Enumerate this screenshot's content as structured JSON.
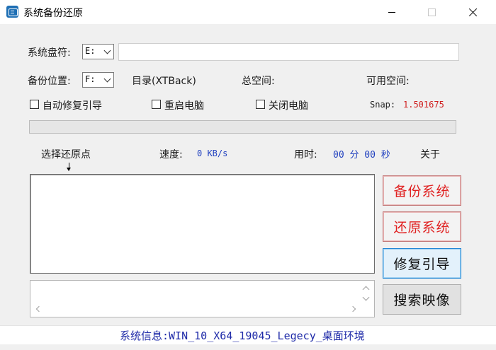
{
  "window": {
    "title": "系统备份还原",
    "icon": "app-window-icon"
  },
  "titlebar": {
    "minimize": "minimize-icon",
    "maximize": "maximize-icon",
    "close": "close-icon"
  },
  "system_drive": {
    "label": "系统盘符:",
    "selected": "E:",
    "path_value": ""
  },
  "backup_location": {
    "label": "备份位置:",
    "selected": "F:",
    "directory": "目录(XTBack)",
    "total_space_label": "总空间:",
    "free_space_label": "可用空间:"
  },
  "options": {
    "auto_repair_boot": "自动修复引导",
    "restart": "重启电脑",
    "shutdown": "关闭电脑",
    "snap_label": "Snap:",
    "snap_value": "1.501675"
  },
  "progress": {
    "value": 0
  },
  "status_row": {
    "select_restore_point": "选择还原点",
    "speed_label": "速度:",
    "speed_value": "0 KB/s",
    "elapsed_label": "用时:",
    "elapsed_value": "00 分 00 秒",
    "about": "关于"
  },
  "buttons": {
    "backup": "备份系统",
    "restore": "还原系统",
    "repair_boot": "修复引导",
    "search_image": "搜索映像"
  },
  "restore_points": [],
  "log_text": "",
  "statusbar": {
    "system_info": "系统信息:WIN_10_X64_19045_Legecy_桌面环境"
  },
  "colors": {
    "accent_red": "#e02020",
    "accent_blue": "#1f86d6",
    "status_text": "#1e2aa8",
    "value_text": "#1f3fbf",
    "snap_value": "#d02020"
  }
}
